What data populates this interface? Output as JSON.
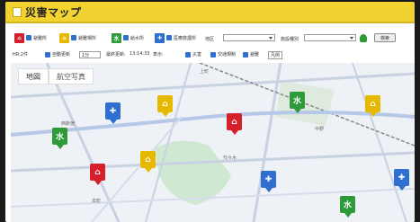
{
  "app": {
    "title": "災害マップ"
  },
  "filters": [
    {
      "label": "避難所",
      "icon": "evacuation-icon",
      "color": "#d61f2b"
    },
    {
      "label": "避難場所",
      "icon": "shelter-icon",
      "color": "#e6b800"
    },
    {
      "label": "給水所",
      "icon": "water-icon",
      "color": "#2f9a3a"
    },
    {
      "label": "医療救護所",
      "icon": "medical-icon",
      "color": "#2e6fd0"
    }
  ],
  "selects": [
    {
      "label": "地区"
    },
    {
      "label": "施設種別"
    }
  ],
  "search_button": "検索",
  "status": {
    "count": "HR:2件",
    "auto_update": "自動更新",
    "interval": "1分",
    "last_update_label": "最終更新:",
    "last_update": "13:14:33",
    "display_label": "表示:",
    "options": [
      "災害",
      "交通規制",
      "避難"
    ],
    "legend": "凡例"
  },
  "map": {
    "tabs": [
      "地図",
      "航空写真"
    ],
    "labels": [
      "西新宿",
      "上町",
      "代々木",
      "中野",
      "本町"
    ]
  },
  "colors": {
    "title_bar": "#f2d230",
    "accent_blue": "#2e6fd0",
    "pin_red": "#d61f2b",
    "pin_green": "#2f9a3a",
    "pin_yellow": "#e6b800"
  }
}
